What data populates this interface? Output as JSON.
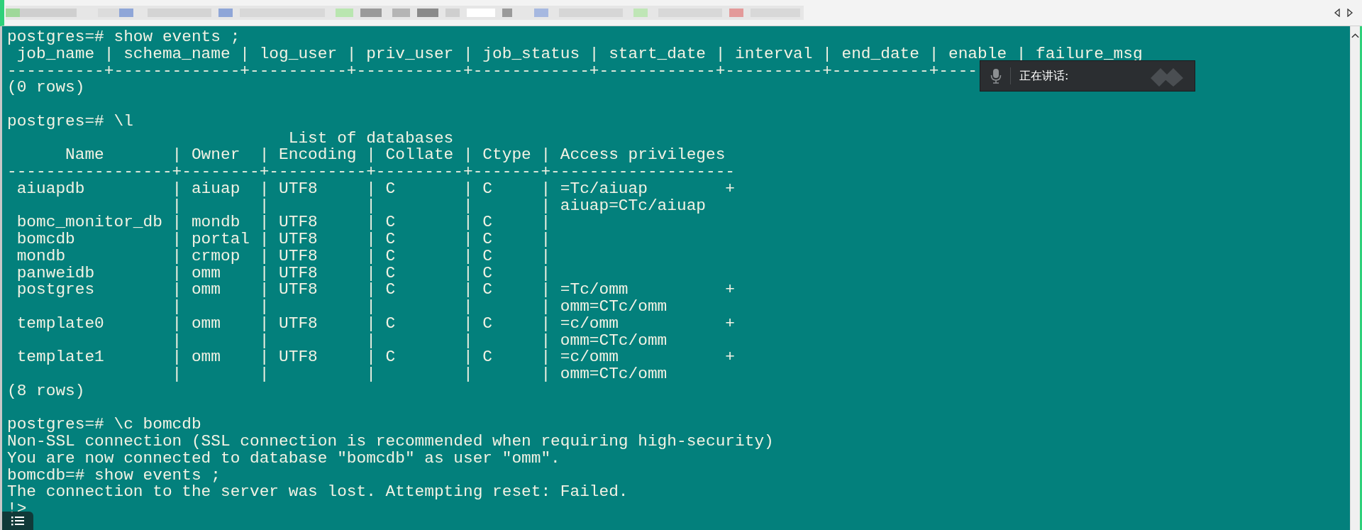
{
  "terminal": {
    "lines": [
      {
        "kind": "text",
        "text": "postgres=# show events ;"
      },
      {
        "kind": "text",
        "text": " job_name | schema_name | log_user | priv_user | job_status | start_date | interval | end_date | enable | failure_msg"
      },
      {
        "kind": "text",
        "text": "----------+-------------+----------+-----------+------------+------------+----------+----------+----"
      },
      {
        "kind": "text",
        "text": "(0 rows)"
      },
      {
        "kind": "blank"
      },
      {
        "kind": "text",
        "text": "postgres=# \\l"
      },
      {
        "kind": "text",
        "text": "                             List of databases"
      },
      {
        "kind": "text",
        "text": "      Name       | Owner  | Encoding | Collate | Ctype | Access privileges"
      },
      {
        "kind": "text",
        "text": "-----------------+--------+----------+---------+-------+-------------------"
      },
      {
        "kind": "text",
        "text": " aiuapdb         | aiuap  | UTF8     | C       | C     | =Tc/aiuap        +"
      },
      {
        "kind": "text",
        "text": "                 |        |          |         |       | aiuap=CTc/aiuap"
      },
      {
        "kind": "text",
        "text": " bomc_monitor_db | mondb  | UTF8     | C       | C     |"
      },
      {
        "kind": "text",
        "text": " bomcdb          | portal | UTF8     | C       | C     |"
      },
      {
        "kind": "text",
        "text": " mondb           | crmop  | UTF8     | C       | C     |"
      },
      {
        "kind": "text",
        "text": " panweidb        | omm    | UTF8     | C       | C     |"
      },
      {
        "kind": "text",
        "text": " postgres        | omm    | UTF8     | C       | C     | =Tc/omm          +"
      },
      {
        "kind": "text",
        "text": "                 |        |          |         |       | omm=CTc/omm"
      },
      {
        "kind": "text",
        "text": " template0       | omm    | UTF8     | C       | C     | =c/omm           +"
      },
      {
        "kind": "text",
        "text": "                 |        |          |         |       | omm=CTc/omm"
      },
      {
        "kind": "text",
        "text": " template1       | omm    | UTF8     | C       | C     | =c/omm           +"
      },
      {
        "kind": "text",
        "text": "                 |        |          |         |       | omm=CTc/omm"
      },
      {
        "kind": "text",
        "text": "(8 rows)"
      },
      {
        "kind": "blank"
      },
      {
        "kind": "text",
        "text": "postgres=# \\c bomcdb"
      },
      {
        "kind": "text",
        "text": "Non-SSL connection (SSL connection is recommended when requiring high-security)"
      },
      {
        "kind": "text",
        "text": "You are now connected to database \"bomcdb\" as user \"omm\"."
      },
      {
        "kind": "text",
        "text": "bomcdb=# show events ;"
      },
      {
        "kind": "text",
        "text": "The connection to the server was lost. Attempting reset: Failed."
      },
      {
        "kind": "text",
        "text": "!>"
      }
    ]
  },
  "voice_popup": {
    "label": "正在讲话:"
  }
}
